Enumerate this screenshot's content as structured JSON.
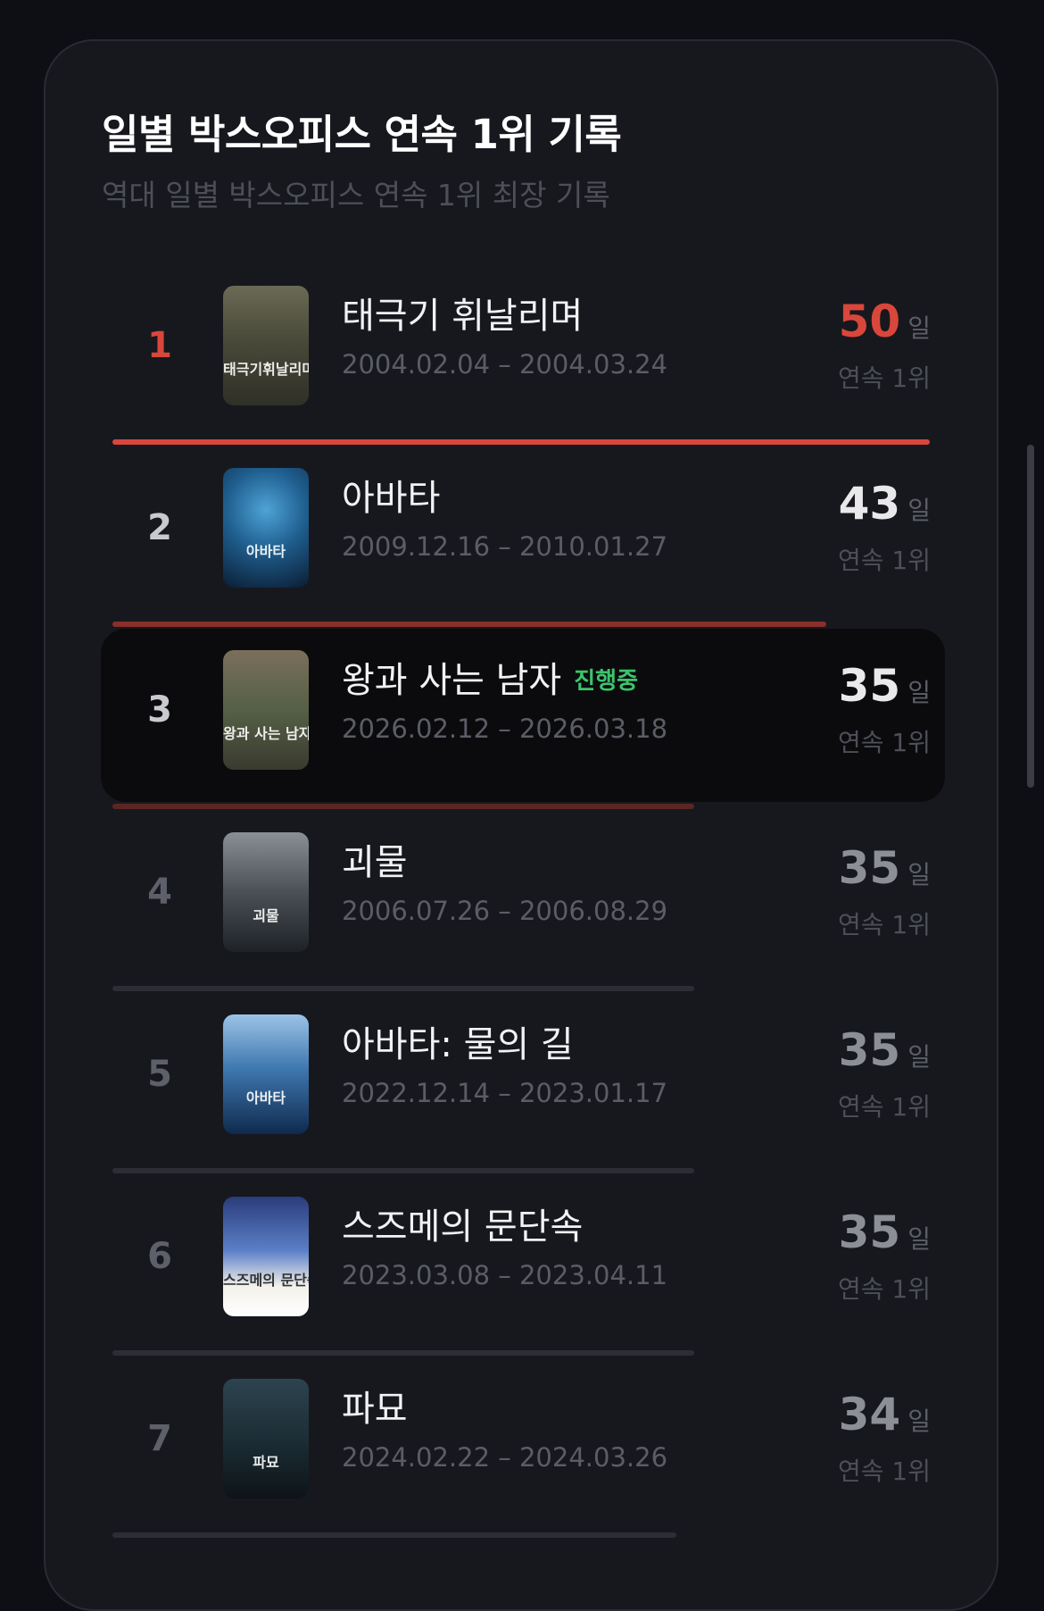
{
  "header": {
    "title": "일별 박스오피스 연속 1위 기록",
    "subtitle": "역대 일별 박스오피스 연속 1위 최장 기록"
  },
  "colors": {
    "accent": "#d9473b",
    "live": "#3cc46b",
    "bar_muted": "#2d2e35",
    "bar_accent": "#8a2f2a"
  },
  "entries": [
    {
      "rank": "1",
      "title": "태극기 휘날리며",
      "dates": "2004.02.04 – 2004.03.24",
      "days": "50",
      "unit": "일",
      "label": "연속 1위",
      "live": "",
      "poster_text": "태극기휘날리며",
      "poster_icon": "war-film-poster"
    },
    {
      "rank": "2",
      "title": "아바타",
      "dates": "2009.12.16 – 2010.01.27",
      "days": "43",
      "unit": "일",
      "label": "연속 1위",
      "live": "",
      "poster_text": "아바타",
      "poster_icon": "blue-face-poster"
    },
    {
      "rank": "3",
      "title": "왕과 사는 남자",
      "dates": "2026.02.12 – 2026.03.18",
      "days": "35",
      "unit": "일",
      "label": "연속 1위",
      "live": "진행중",
      "poster_text": "왕과 사는 남자",
      "poster_icon": "palace-gate-poster"
    },
    {
      "rank": "4",
      "title": "괴물",
      "dates": "2006.07.26 – 2006.08.29",
      "days": "35",
      "unit": "일",
      "label": "연속 1위",
      "live": "",
      "poster_text": "괴물",
      "poster_icon": "family-portrait-poster"
    },
    {
      "rank": "5",
      "title": "아바타: 물의 길",
      "dates": "2022.12.14 – 2023.01.17",
      "days": "35",
      "unit": "일",
      "label": "연속 1위",
      "live": "",
      "poster_text": "아바타",
      "poster_icon": "ocean-poster"
    },
    {
      "rank": "6",
      "title": "스즈메의 문단속",
      "dates": "2023.03.08 – 2023.04.11",
      "days": "35",
      "unit": "일",
      "label": "연속 1위",
      "live": "",
      "poster_text": "스즈메의 문단속",
      "poster_icon": "anime-door-poster"
    },
    {
      "rank": "7",
      "title": "파묘",
      "dates": "2024.02.22 – 2024.03.26",
      "days": "34",
      "unit": "일",
      "label": "연속 1위",
      "live": "",
      "poster_text": "파묘",
      "poster_icon": "mystery-poster"
    }
  ]
}
